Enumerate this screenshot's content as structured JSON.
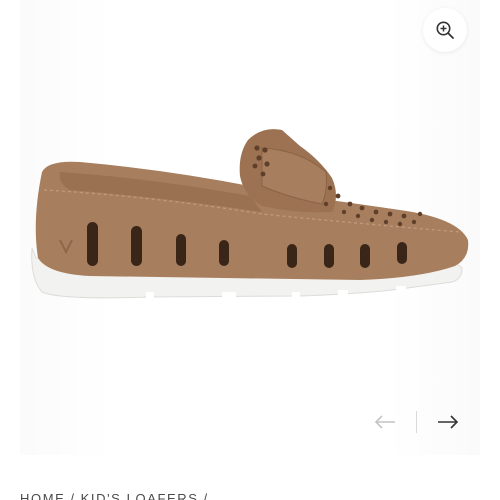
{
  "gallery": {
    "zoom_icon": "zoom-in-icon",
    "prev_icon": "arrow-left-icon",
    "next_icon": "arrow-right-icon",
    "product_image_alt": "Kid's loafer"
  },
  "breadcrumb": {
    "items": [
      "HOME",
      "KID'S LOAFERS"
    ],
    "separator": "/"
  },
  "colors": {
    "shoe_upper": "#a87f5e",
    "shoe_upper_dark": "#8e6749",
    "sole": "#f2f2f0",
    "arrow_disabled": "#c4c4c4",
    "arrow_active": "#333333",
    "breadcrumb_text": "#4a4a4a"
  }
}
